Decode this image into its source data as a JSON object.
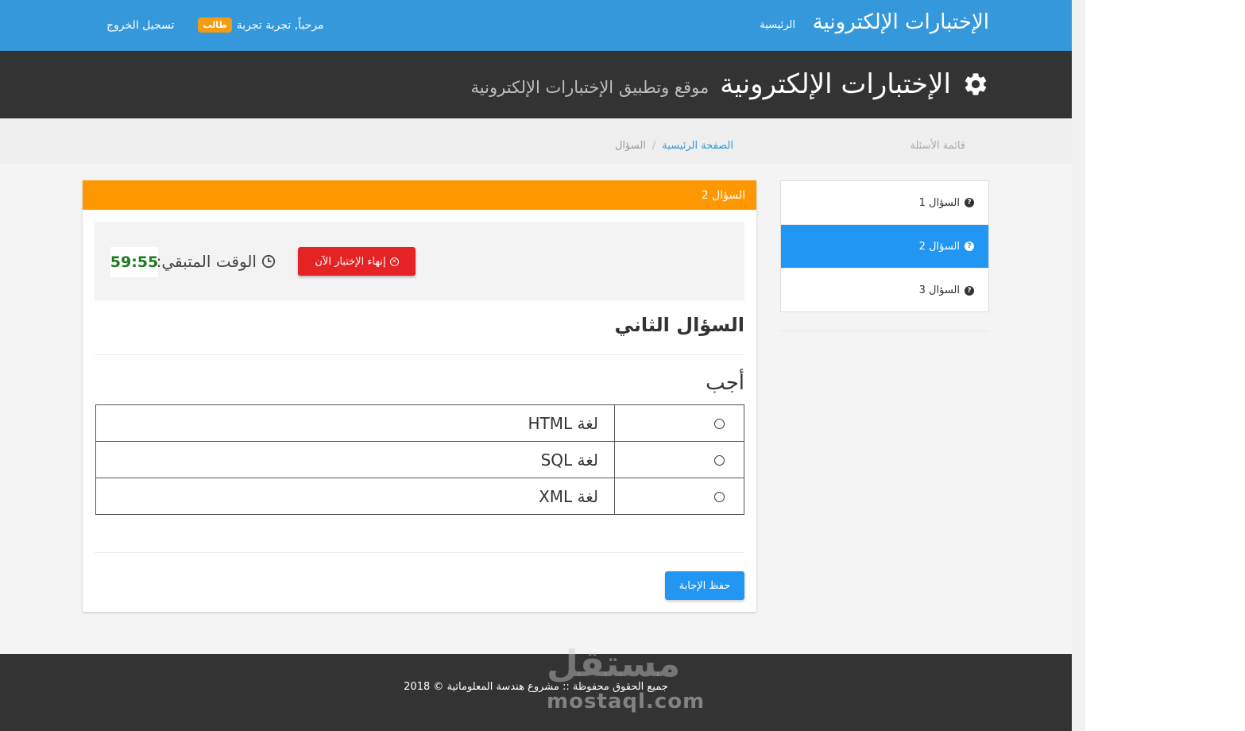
{
  "topbar": {
    "brand": "الإختبارات الإلكترونية",
    "home_link": "الرئيسية",
    "welcome": "مرحباً, تجربة تجربة",
    "role_badge": "طالب",
    "logout": "تسجيل الخروج"
  },
  "header": {
    "title": "الإختبارات الإلكترونية",
    "subtitle": "موقع وتطبيق الإختبارات الإلكترونية",
    "icon": "gear-icon"
  },
  "breadcrumb": {
    "question_list_label": "قائمة الأسئلة",
    "home": "الصفحة الرئيسية",
    "separator": "/",
    "current": "السؤال"
  },
  "sidebar": {
    "items": [
      {
        "label": "السؤال 1",
        "active": false
      },
      {
        "label": "السؤال 2",
        "active": true
      },
      {
        "label": "السؤال 3",
        "active": false
      }
    ]
  },
  "panel": {
    "heading": "السؤال 2",
    "timer_label": "الوقت المتبقي:",
    "timer_value": "59:55",
    "end_button": "إنهاء الإختبار الآن",
    "question_title": "السؤال الثاني",
    "answer_prompt": "أجب",
    "options": [
      "لغة HTML",
      "لغة SQL",
      "لغة XML"
    ],
    "save_button": "حفظ الإجابة"
  },
  "footer": {
    "copyright": "جميع الحقوق محفوظة :: مشروع هندسة المعلوماتية © 2018"
  },
  "watermark": {
    "arabic": "مستقل",
    "latin": "mostaql.com"
  },
  "colors": {
    "topbar": "#3498db",
    "header": "#333333",
    "panel_heading": "#ff9800",
    "active_item": "#2196f3",
    "danger": "#e52224",
    "timer_text": "#1e7b1e"
  }
}
